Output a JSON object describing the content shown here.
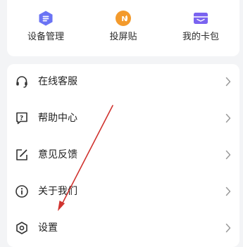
{
  "shortcuts": [
    {
      "label": "设备管理",
      "icon": "device-hexagon-icon",
      "color": "#6a73f4"
    },
    {
      "label": "投屏贴",
      "icon": "nfc-sticker-icon",
      "color": "#f39a2c"
    },
    {
      "label": "我的卡包",
      "icon": "wallet-card-icon",
      "color": "#7a63f0"
    }
  ],
  "menu": {
    "items": [
      {
        "label": "在线客服",
        "icon": "headset-icon"
      },
      {
        "label": "帮助中心",
        "icon": "help-question-icon"
      },
      {
        "label": "意见反馈",
        "icon": "feedback-edit-icon"
      },
      {
        "label": "关于我们",
        "icon": "info-icon"
      },
      {
        "label": "设置",
        "icon": "settings-hexagon-icon"
      }
    ]
  },
  "annotation": {
    "color": "#d0332f"
  }
}
